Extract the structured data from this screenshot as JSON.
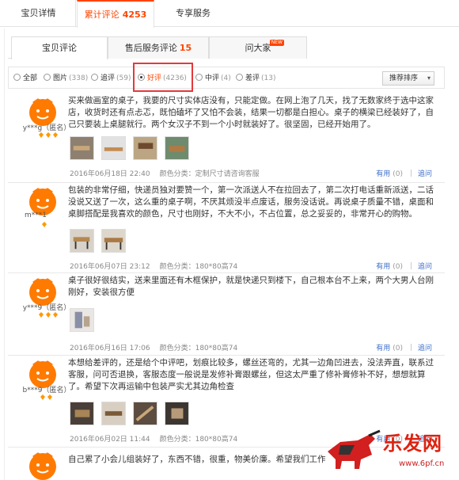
{
  "top_tabs": [
    {
      "label": "宝贝详情"
    },
    {
      "label": "累计评论",
      "count": "4253"
    },
    {
      "label": "专享服务"
    }
  ],
  "sub_tabs": [
    {
      "label": "宝贝评论"
    },
    {
      "label": "售后服务评论",
      "count": "15"
    },
    {
      "label": "问大家",
      "badge": "NEW"
    }
  ],
  "filters": [
    {
      "label": "全部",
      "count": ""
    },
    {
      "label": "图片",
      "count": "(338)"
    },
    {
      "label": "追评",
      "count": "(59)"
    },
    {
      "label": "好评",
      "count": "(4236)",
      "selected": true
    },
    {
      "label": "中评",
      "count": "(4)"
    },
    {
      "label": "差评",
      "count": "(13)"
    }
  ],
  "sort": {
    "label": "推荐排序"
  },
  "reviews": [
    {
      "user": "y***g（匿名）",
      "text": "买来做画室的桌子，我要的尺寸实体店没有，只能定做。在网上泡了几天，找了无数家终于选中这家店，收货时还有点忐忑，既怕磕坏了又怕不会装，结果一切都是白担心。桌子的横梁已经装好了，自己只要装上桌腿就行。两个女汉子不到一个小时就装好了。很坚固，已经开始用了。",
      "date": "2016年06月18日 22:40",
      "spec": "颜色分类：定制尺寸请咨询客服",
      "useful": "有用",
      "useful_count": "(0)",
      "reply": "追问"
    },
    {
      "user": "m***1",
      "text": "包装的非常仔细，快递员独对要赞一个，第一次派送人不在拉回去了，第二次打电话重新派送，二话没说又送了一次，这么重的桌子啊，不厌其烦没半点废话，服务没话说。再说桌子质量不错，桌面和桌脚搭配是我喜欢的颜色，尺寸也刚好，不大不小，不占位置，总之妥妥的，非常开心的购物。",
      "date": "2016年06月07日 23:12",
      "spec": "颜色分类：180*80高74",
      "useful": "有用",
      "useful_count": "(0)",
      "reply": "追问"
    },
    {
      "user": "y***9（匿名）",
      "text": "桌子很好很结实，送来里面还有木框保护，就是快递只到楼下，自己根本台不上来，两个大男人台刚刚好，安装很方便",
      "date": "2016年06月16日 17:06",
      "spec": "颜色分类：180*80高74",
      "useful": "有用",
      "useful_count": "(0)",
      "reply": "追问"
    },
    {
      "user": "b***9（匿名）",
      "text": "本想给差评的，还是给个中评吧，划痕比较多，螺丝还弯的，尤其一边角凹进去，没法弄直，联系过客服，问可否退换，客服态度一般说是发修补膏跟螺丝，但这太严重了修补膏修补不好，想想就算了。希望下次再运输中包装严实尤其边角检查",
      "date": "2016年06月02日 11:44",
      "spec": "颜色分类：180*80高74",
      "useful": "有用",
      "useful_count": "(0)",
      "reply": "追问"
    },
    {
      "user": "",
      "text": "自己累了小会儿组装好了，东西不错，很重，物美价廉。希望我们工作"
    }
  ],
  "watermark": {
    "title": "乐发网",
    "url": "www.6pf.cn"
  },
  "colors": {
    "accent": "#ff4400",
    "link": "#3d6ec9",
    "highlight_box": "#e4393c"
  }
}
